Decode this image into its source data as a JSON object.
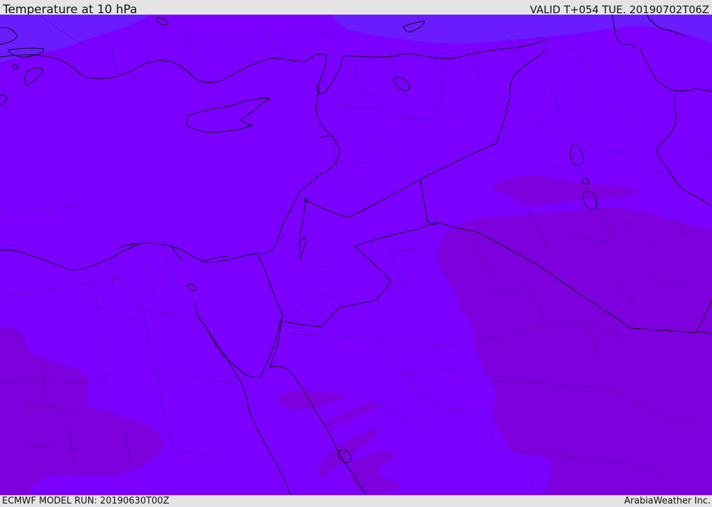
{
  "header": {
    "title": "Temperature at 10 hPa",
    "valid": "VALID T+054 TUE. 20190702T06Z"
  },
  "footer": {
    "model_run": "ECMWF MODEL RUN: 20190630T00Z",
    "credit": "ArabiaWeather Inc."
  },
  "colors": {
    "field_main": "#7b00ff",
    "field_cooler": "#6a1cff",
    "field_warmer": "#7d00dd",
    "coastline": "#101018",
    "border_dotted": "#3a0f6e"
  }
}
